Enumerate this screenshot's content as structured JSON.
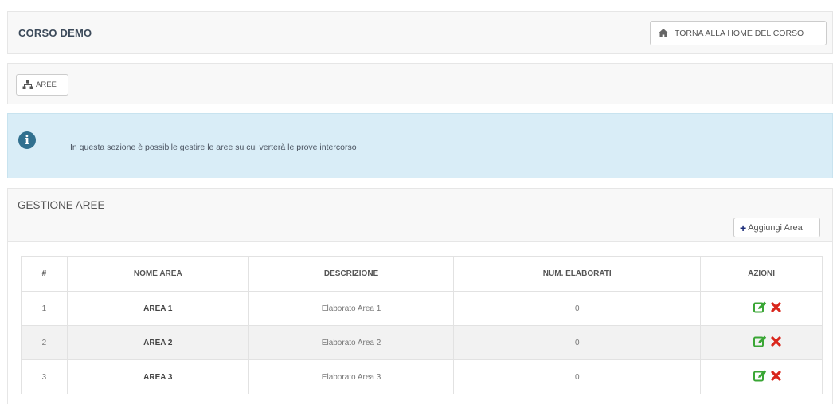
{
  "header": {
    "title": "CORSO DEMO",
    "home_button": "TORNA ALLA HOME DEL CORSO",
    "home_icon": "home-icon"
  },
  "nav": {
    "areas_tab": "AREE",
    "areas_icon": "sitemap-icon"
  },
  "info": {
    "icon": "info-circle-icon",
    "message": "In questa sezione è possibile gestire le aree su cui verterà le prove intercorso"
  },
  "management": {
    "title": "GESTIONE AREE",
    "add_button": "Aggiungi Area",
    "add_icon": "plus-icon"
  },
  "table": {
    "headers": [
      "#",
      "NOME AREA",
      "DESCRIZIONE",
      "NUM. ELABORATI",
      "AZIONI"
    ],
    "rows": [
      {
        "num": "1",
        "name": "AREA 1",
        "description": "Elaborato Area 1",
        "count": "0"
      },
      {
        "num": "2",
        "name": "AREA 2",
        "description": "Elaborato Area 2",
        "count": "0"
      },
      {
        "num": "3",
        "name": "AREA 3",
        "description": "Elaborato Area 3",
        "count": "0"
      }
    ],
    "action_icons": [
      "edit-icon",
      "delete-icon"
    ]
  },
  "colors": {
    "info_background": "#d9edf7",
    "info_icon": "#31708f",
    "edit_green": "#3aa635",
    "delete_red": "#d9261c",
    "plus_blue": "#1d2e7a"
  }
}
